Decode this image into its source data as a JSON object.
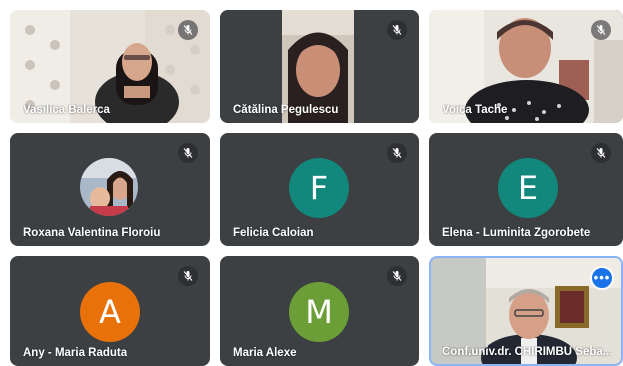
{
  "participants": [
    {
      "name": "Vasilica Balerca",
      "muted": true
    },
    {
      "name": "Cătălina Pegulescu",
      "muted": true
    },
    {
      "name": "Voica Tache",
      "muted": true
    },
    {
      "name": "Roxana Valentina Floroiu",
      "muted": true
    },
    {
      "name": "Felicia Caloian",
      "initial": "F",
      "avatar_color": "#12877b",
      "muted": true
    },
    {
      "name": "Elena - Luminita Zgorobete",
      "initial": "E",
      "avatar_color": "#12877b",
      "muted": true
    },
    {
      "name": "Any - Maria Raduta",
      "initial": "A",
      "avatar_color": "#e8710a",
      "muted": true
    },
    {
      "name": "Maria Alexe",
      "initial": "M",
      "avatar_color": "#6b9e36",
      "muted": true
    },
    {
      "name": "Conf.univ.dr. CHIRIMBU Sebastian",
      "display_name": "Conf.univ.dr. CHIRIMBU Seba...",
      "muted": false
    }
  ],
  "icons": {
    "mute": "mic-off-icon",
    "more": "more-options-icon"
  },
  "colors": {
    "tile_bg": "#3c4043",
    "active_border": "#8ab4f8",
    "more_button": "#1a73e8"
  }
}
